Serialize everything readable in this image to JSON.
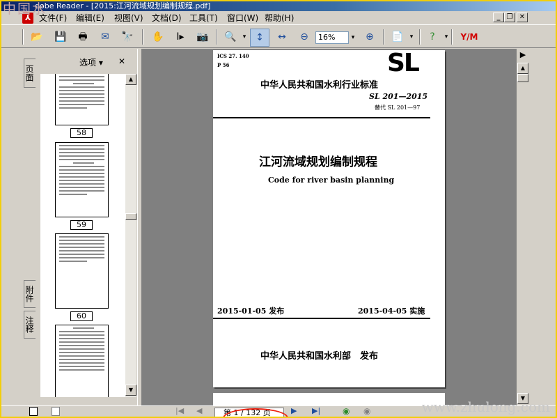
{
  "window": {
    "title": "dobe Reader - [2015:江河流域规划编制规程.pdf]",
    "watermark_left": "中国水",
    "watermark_right": "www.zhulong.com"
  },
  "menu": {
    "items": [
      "文件(F)",
      "编辑(E)",
      "视图(V)",
      "文档(D)",
      "工具(T)",
      "窗口(W)",
      "帮助(H)"
    ]
  },
  "toolbar": {
    "zoom_value": "16%"
  },
  "nav": {
    "options_label": "选项 ▾",
    "close_label": "✕",
    "tabs": {
      "pages": "页面",
      "attachments": "附件",
      "comments": "注释"
    },
    "thumbnails": [
      {
        "label": "58"
      },
      {
        "label": "59"
      },
      {
        "label": "60"
      }
    ]
  },
  "document": {
    "ics": "ICS 27. 140",
    "p_code": "P 56",
    "logo": "SL",
    "standard_org": "中华人民共和国水利行业标准",
    "standard_number": "SL 201—2015",
    "replaces": "替代 SL 201—97",
    "title_cn": "江河流域规划编制规程",
    "title_en": "Code for river basin planning",
    "issue_date": "2015-01-05 发布",
    "effective_date": "2015-04-05 实施",
    "publisher": "中华人民共和国水利部　发布"
  },
  "status": {
    "page_indicator": "第 1 / 132 页"
  },
  "colors": {
    "frame_border": "#f2ce0a",
    "titlebar": "#0a246a",
    "chrome": "#d4d0c8",
    "doc_background": "#808080",
    "highlight_oval": "#e21111"
  }
}
